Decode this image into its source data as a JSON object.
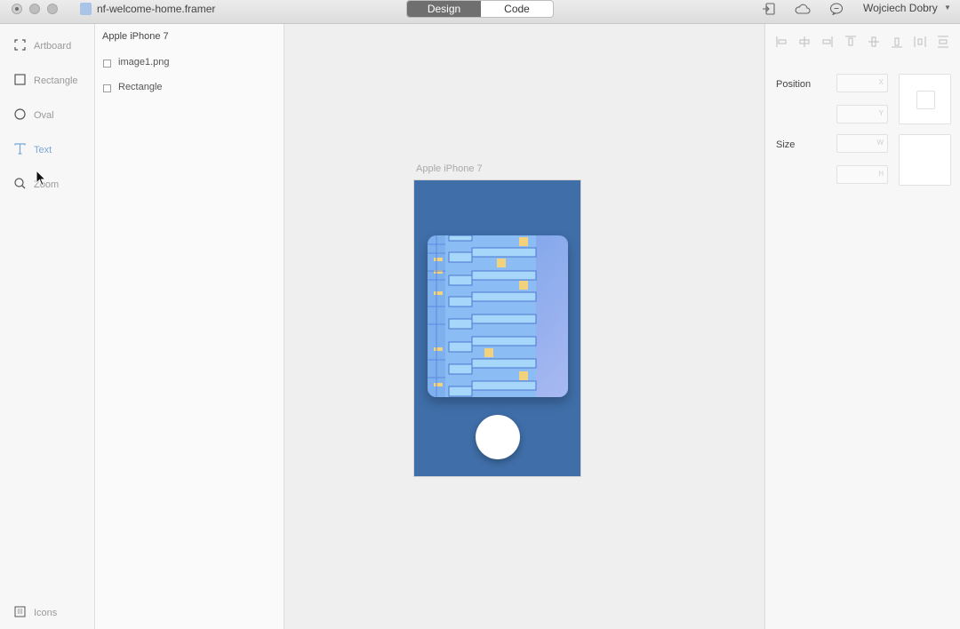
{
  "window": {
    "title": "nf-welcome-home.framer",
    "user": "Wojciech Dobry"
  },
  "mode_tabs": [
    {
      "label": "Design",
      "active": true
    },
    {
      "label": "Code",
      "active": false
    }
  ],
  "toolbar_icons": [
    "preview-icon",
    "cloud-icon",
    "comment-icon"
  ],
  "tools": [
    {
      "label": "Artboard",
      "icon": "artboard-icon"
    },
    {
      "label": "Rectangle",
      "icon": "rectangle-icon"
    },
    {
      "label": "Oval",
      "icon": "oval-icon"
    },
    {
      "label": "Text",
      "icon": "text-icon",
      "active": true
    },
    {
      "label": "Zoom",
      "icon": "zoom-icon"
    },
    {
      "label": "Icons",
      "icon": "grid-icon"
    }
  ],
  "layers": {
    "root": "Apple iPhone 7",
    "items": [
      {
        "label": "image1.png"
      },
      {
        "label": "Rectangle"
      }
    ]
  },
  "canvas": {
    "artboard_label": "Apple iPhone 7",
    "artboard_color": "#3f6ea8"
  },
  "inspector": {
    "position_label": "Position",
    "size_label": "Size",
    "fields": {
      "x": "X",
      "y": "Y",
      "w": "W",
      "h": "H"
    }
  },
  "colors": {
    "accent": "#7aa7d6",
    "artboard": "#3f6ea8",
    "active_tab": "#6f6f6f"
  }
}
